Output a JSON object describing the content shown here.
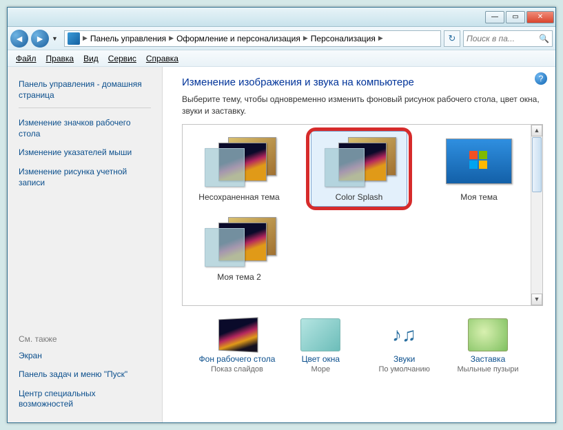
{
  "breadcrumb": {
    "seg1": "Панель управления",
    "seg2": "Оформление и персонализация",
    "seg3": "Персонализация"
  },
  "search": {
    "placeholder": "Поиск в па..."
  },
  "menu": {
    "file": "Файл",
    "edit": "Правка",
    "view": "Вид",
    "tools": "Сервис",
    "help": "Справка"
  },
  "sidebar": {
    "home": "Панель управления - домашняя страница",
    "links": [
      "Изменение значков рабочего стола",
      "Изменение указателей мыши",
      "Изменение рисунка учетной записи"
    ],
    "see_also_label": "См. также",
    "see_also": [
      "Экран",
      "Панель задач и меню \"Пуск\"",
      "Центр специальных возможностей"
    ]
  },
  "main": {
    "heading": "Изменение изображения и звука на компьютере",
    "subtext": "Выберите тему, чтобы одновременно изменить фоновый рисунок рабочего стола, цвет окна, звуки и заставку."
  },
  "themes": [
    {
      "name": "Несохраненная тема"
    },
    {
      "name": "Color Splash"
    },
    {
      "name": "Моя тема"
    },
    {
      "name": "Моя тема 2"
    }
  ],
  "bottom": {
    "desktop": {
      "link": "Фон рабочего стола",
      "sub": "Показ слайдов"
    },
    "color": {
      "link": "Цвет окна",
      "sub": "Море"
    },
    "sounds": {
      "link": "Звуки",
      "sub": "По умолчанию"
    },
    "screen": {
      "link": "Заставка",
      "sub": "Мыльные пузыри"
    }
  }
}
